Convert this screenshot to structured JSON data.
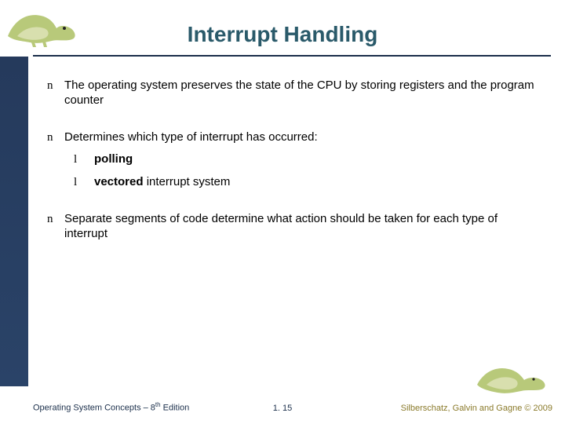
{
  "title": "Interrupt Handling",
  "bullets": {
    "b1": "The operating system preserves the state of the CPU by storing registers and the program counter",
    "b2": "Determines which type of interrupt has occurred:",
    "b2a_bold": "polling",
    "b2b_bold": "vectored",
    "b2b_rest": " interrupt system",
    "b3": "Separate segments of code determine what action should be taken for each type of interrupt"
  },
  "footer": {
    "left_a": "Operating System Concepts – 8",
    "left_sup": "th",
    "left_b": " Edition",
    "center": "1. 15",
    "right": "Silberschatz, Galvin and Gagne © 2009"
  },
  "marks": {
    "n": "n",
    "l": "l"
  },
  "colors": {
    "title": "#2a5a6a",
    "rule": "#1a2e4a",
    "sidebar_top": "#253a5c",
    "sidebar_bot": "#2a4368",
    "foot_right": "#8a7a2a",
    "dino_body": "#b8c97a",
    "dino_belly": "#d8dfae"
  }
}
